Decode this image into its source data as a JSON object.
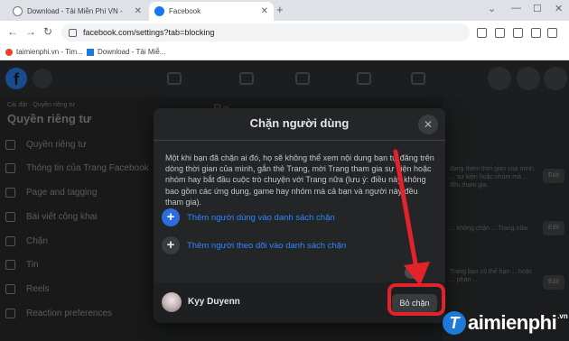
{
  "browser": {
    "tabs": [
      {
        "title": "Download - Tải Miễn Phí VN - "
      },
      {
        "title": "Facebook"
      }
    ],
    "url": "facebook.com/settings?tab=blocking",
    "bookmarks": [
      {
        "label": "taimienphi.vn - Tim..."
      },
      {
        "label": "Download - Tải Miễ..."
      }
    ]
  },
  "fb": {
    "logo": "f",
    "sidebar": {
      "breadcrumb": "Cài đặt · Quyền riêng tư",
      "title": "Quyền riêng tư",
      "items": [
        {
          "label": "Quyền riêng tư"
        },
        {
          "label": "Thông tin của Trang Facebook"
        },
        {
          "label": "Page and tagging"
        },
        {
          "label": "Bài viết công khai"
        },
        {
          "label": "Chặn"
        },
        {
          "label": "Tin"
        },
        {
          "label": "Reels"
        },
        {
          "label": "Reaction preferences"
        }
      ]
    },
    "bg_title": "Ba",
    "right_texts": [
      "đang thêm thời gian của mình, ... sự kiện hoặc nhóm mà ... đều tham gia.",
      "... không chặn ... Trang nữa",
      "Trang bạn có thể bạn ... hoặc ... phản ...",
      "... "
    ],
    "edit_label": "Edit"
  },
  "modal": {
    "title": "Chặn người dùng",
    "description": "Một khi bạn đã chặn ai đó, họ sẽ không thể xem nội dung bạn tự đăng trên dòng thời gian của mình, gắn thẻ Trang, mời Trang tham gia sự kiện hoặc nhóm hay bắt đầu cuộc trò chuyện với Trang nữa (lưu ý: điều này không bao gồm các ứng dụng, game hay nhóm mà cả bạn và người này đều tham gia).",
    "add_blocked": "Thêm người dùng vào danh sách chặn",
    "add_followers": "Thêm người theo dõi vào danh sách chặn",
    "user": {
      "name": "Kyy Duyenn"
    },
    "unblock_label": "Bỏ chặn"
  },
  "watermark": {
    "brand_t": "T",
    "brand_rest": "aimienphi",
    "suffix": ".vn"
  },
  "colors": {
    "accent": "#2d88ff",
    "annotation": "#e3222b",
    "fb_blue": "#1877f2"
  }
}
